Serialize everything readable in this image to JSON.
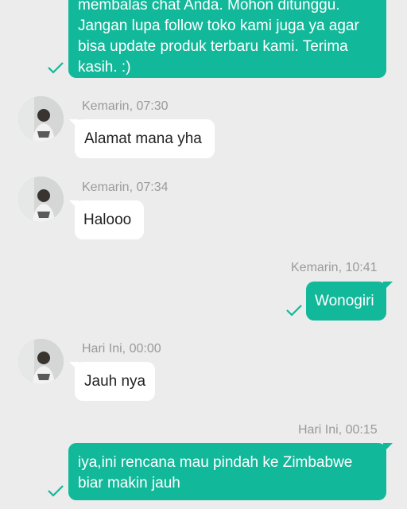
{
  "colors": {
    "background": "#ececec",
    "outgoing_bubble": "#12b89a",
    "incoming_bubble": "#ffffff",
    "read_check": "#12b89a",
    "timestamp": "#9a9a9a"
  },
  "messages": [
    {
      "direction": "outgoing",
      "time": "",
      "lines": [
        "membalas chat Anda. Mohon ditunggu.",
        "Jangan lupa follow toko kami juga ya agar",
        "bisa update produk terbaru kami. Terima",
        "kasih. :)"
      ],
      "status_icon": "check-icon"
    },
    {
      "direction": "incoming",
      "time": "Kemarin, 07:30",
      "lines": [
        "Alamat mana yha"
      ],
      "avatar_icon": "avatar"
    },
    {
      "direction": "incoming",
      "time": "Kemarin, 07:34",
      "lines": [
        "Halooo"
      ],
      "avatar_icon": "avatar"
    },
    {
      "direction": "outgoing",
      "time": "Kemarin, 10:41",
      "lines": [
        "Wonogiri"
      ],
      "status_icon": "check-icon"
    },
    {
      "direction": "incoming",
      "time": "Hari Ini, 00:00",
      "lines": [
        "Jauh nya"
      ],
      "avatar_icon": "avatar"
    },
    {
      "direction": "outgoing",
      "time": "Hari Ini, 00:15",
      "lines": [
        "iya,ini rencana mau pindah ke Zimbabwe",
        "biar makin jauh"
      ],
      "status_icon": "check-icon"
    }
  ]
}
